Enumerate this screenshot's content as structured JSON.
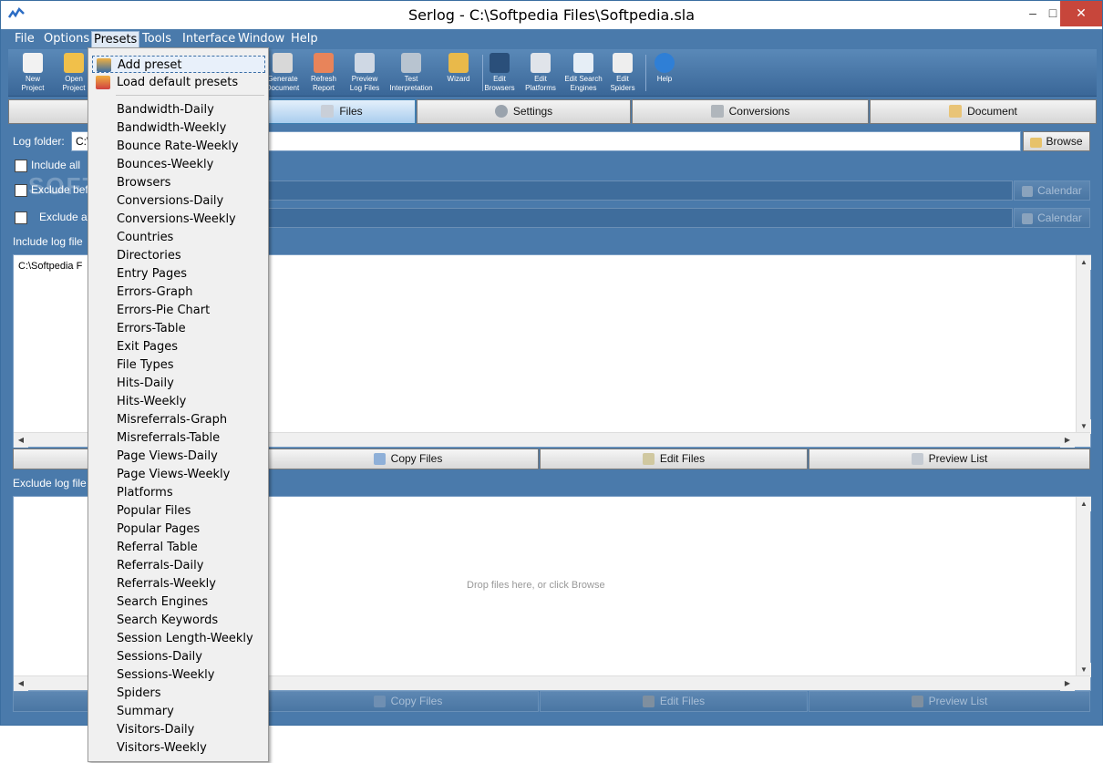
{
  "window": {
    "title": "Serlog - C:\\Softpedia Files\\Softpedia.sla"
  },
  "menubar": [
    {
      "label": "File"
    },
    {
      "label": "Options"
    },
    {
      "label": "Presets"
    },
    {
      "label": "Tools"
    },
    {
      "label": "Interface"
    },
    {
      "label": "Window"
    },
    {
      "label": "Help"
    }
  ],
  "toolbar": [
    {
      "line1": "New",
      "line2": "Project",
      "icon": "new-project-icon"
    },
    {
      "line1": "Open",
      "line2": "Project",
      "icon": "open-project-icon"
    },
    {
      "line1": "Generate",
      "line2": "Document",
      "icon": "generate-document-icon"
    },
    {
      "line1": "Refresh",
      "line2": "Report",
      "icon": "refresh-report-icon"
    },
    {
      "line1": "Preview",
      "line2": "Log Files",
      "icon": "preview-log-files-icon"
    },
    {
      "line1": "Test",
      "line2": "Interpretation",
      "icon": "test-interpretation-icon"
    },
    {
      "line1": "Wizard",
      "line2": "",
      "icon": "wizard-icon"
    },
    {
      "line1": "Edit",
      "line2": "Browsers",
      "icon": "edit-browsers-icon"
    },
    {
      "line1": "Edit",
      "line2": "Platforms",
      "icon": "edit-platforms-icon"
    },
    {
      "line1": "Edit Search",
      "line2": "Engines",
      "icon": "edit-search-engines-icon"
    },
    {
      "line1": "Edit",
      "line2": "Spiders",
      "icon": "edit-spiders-icon"
    },
    {
      "line1": "Help",
      "line2": "",
      "icon": "help-icon"
    }
  ],
  "tabs": [
    {
      "label": "Files",
      "icon": "files-icon"
    },
    {
      "label": "Settings",
      "icon": "settings-icon"
    },
    {
      "label": "Conversions",
      "icon": "cart-icon"
    },
    {
      "label": "Document",
      "icon": "document-icon"
    }
  ],
  "files_panel": {
    "log_folder_label": "Log folder:",
    "log_folder_value": "C:\\",
    "browse_label": "Browse",
    "include_all_label": "Include all",
    "exclude_before_label": "Exclude bef",
    "exclude_after_label": "Exclude af",
    "calendar_label": "Calendar",
    "include_log_files_label": "Include log file",
    "include_list_item": "C:\\Softpedia F",
    "copy_files_label": "Copy Files",
    "edit_files_label": "Edit Files",
    "preview_list_label": "Preview List",
    "exclude_log_files_label": "Exclude log file",
    "exclude_placeholder": "Drop files here, or click Browse",
    "watermark": "SOFTPE"
  },
  "presets_menu": {
    "add_preset": "Add preset",
    "load_default": "Load default presets",
    "items": [
      "Bandwidth-Daily",
      "Bandwidth-Weekly",
      "Bounce Rate-Weekly",
      "Bounces-Weekly",
      "Browsers",
      "Conversions-Daily",
      "Conversions-Weekly",
      "Countries",
      "Directories",
      "Entry Pages",
      "Errors-Graph",
      "Errors-Pie Chart",
      "Errors-Table",
      "Exit Pages",
      "File Types",
      "Hits-Daily",
      "Hits-Weekly",
      "Misreferrals-Graph",
      "Misreferrals-Table",
      "Page Views-Daily",
      "Page Views-Weekly",
      "Platforms",
      "Popular Files",
      "Popular Pages",
      "Referral Table",
      "Referrals-Daily",
      "Referrals-Weekly",
      "Search Engines",
      "Search Keywords",
      "Session Length-Weekly",
      "Sessions-Daily",
      "Sessions-Weekly",
      "Spiders",
      "Summary",
      "Visitors-Daily",
      "Visitors-Weekly"
    ]
  },
  "colors": {
    "accent": "#4a7aab",
    "active_tab": "#a9cdee",
    "close": "#c7463b"
  }
}
